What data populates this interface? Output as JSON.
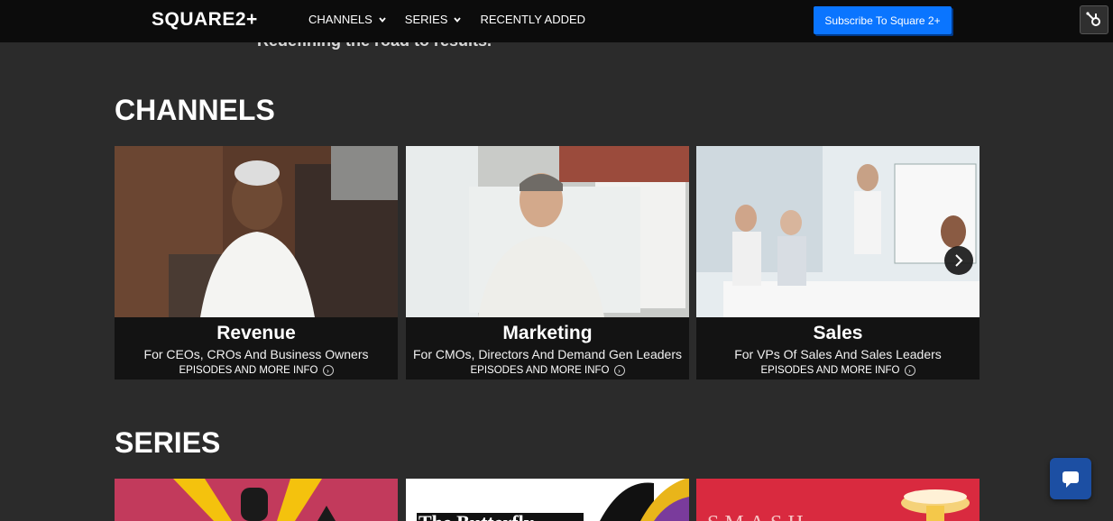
{
  "header": {
    "logo": "SQUARE2+",
    "nav": [
      {
        "label": "CHANNELS",
        "has_dropdown": true
      },
      {
        "label": "SERIES",
        "has_dropdown": true
      },
      {
        "label": "RECENTLY ADDED",
        "has_dropdown": false
      }
    ],
    "subscribe_label": "Subscribe To Square 2+",
    "accent": "#0a75ff"
  },
  "tagline": "Redefining the road to results.",
  "channels": {
    "title": "CHANNELS",
    "cards": [
      {
        "title": "Revenue",
        "subtitle": "For CEOs, CROs And Business Owners",
        "link": "EPISODES AND MORE INFO"
      },
      {
        "title": "Marketing",
        "subtitle": "For CMOs, Directors And Demand Gen Leaders",
        "link": "EPISODES AND MORE INFO"
      },
      {
        "title": "Sales",
        "subtitle": "For VPs Of Sales And Sales Leaders",
        "link": "EPISODES AND MORE INFO"
      }
    ]
  },
  "series": {
    "title": "SERIES",
    "thumbs": [
      {
        "caption": ""
      },
      {
        "caption": "The Butterfly"
      },
      {
        "caption": "SMASH"
      }
    ]
  },
  "icons": {
    "hubspot": "hubspot-icon",
    "next": "chevron-right-icon",
    "chat": "chat-icon",
    "info": "circle-chevron-icon"
  }
}
